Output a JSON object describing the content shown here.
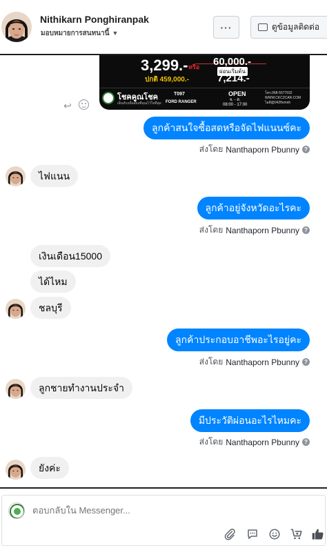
{
  "header": {
    "name": "Nithikarn Ponghiranpak",
    "subtitle": "มอบหมายการสนทนานี้",
    "more_label": "···",
    "contact_label": "ดูข้อมูลติดต่อ"
  },
  "ad": {
    "price": "3,299.-",
    "or": "หรือ",
    "normal_price": "ปกติ 459,000.-",
    "down_payment": "60,000.-",
    "monthly_label": "ผ่อนเริ่มต้น",
    "monthly": "7,214.-",
    "brand": "โชคคูณโชค",
    "brand_sub": "เต็นท์รถมือสองที่คุณไว้ใจที่สุด",
    "code": "T097",
    "model": "FORD RANGER",
    "open": "OPEN",
    "days": "จ. - ส.",
    "hours": "08:00 - 17:00",
    "contact": [
      "โทร.068-5577932",
      "WWW.CKC2CAR.COM",
      "ไอดี@042ftvmnh"
    ]
  },
  "messages": [
    {
      "type": "out",
      "text": "ลูกค้าสนใจซื้อสดหรือจัดไฟแนนซ์คะ",
      "sent_by_label": "ส่งโดย",
      "sender": "Nanthaporn Pbunny"
    },
    {
      "type": "in",
      "text": "ไฟแนน"
    },
    {
      "type": "out",
      "text": "ลูกค้าอยู่จังหวัดอะไรคะ",
      "sent_by_label": "ส่งโดย",
      "sender": "Nanthaporn Pbunny"
    },
    {
      "type": "in",
      "text": "เงินเดือน15000"
    },
    {
      "type": "in",
      "text": "ได้ไหม"
    },
    {
      "type": "in",
      "text": "ชลบุรี"
    },
    {
      "type": "out",
      "text": "ลูกค้าประกอบอาชีพอะไรอยู่คะ",
      "sent_by_label": "ส่งโดย",
      "sender": "Nanthaporn Pbunny"
    },
    {
      "type": "in",
      "text": "ลูกชายทำงานประจำ"
    },
    {
      "type": "out",
      "text": "มีประวัติผ่อนอะไรไหมคะ",
      "sent_by_label": "ส่งโดย",
      "sender": "Nanthaporn Pbunny"
    },
    {
      "type": "in",
      "text": "ยังค่ะ"
    }
  ],
  "composer": {
    "placeholder": "ตอบกลับใน Messenger..."
  },
  "colors": {
    "accent": "#0084ff",
    "incoming_bubble": "#f1f0f0"
  },
  "icons": [
    "reply-icon",
    "emoji-icon",
    "info-icon",
    "attachment-icon",
    "comment-icon",
    "emoji-icon",
    "cart-icon",
    "like-icon"
  ]
}
